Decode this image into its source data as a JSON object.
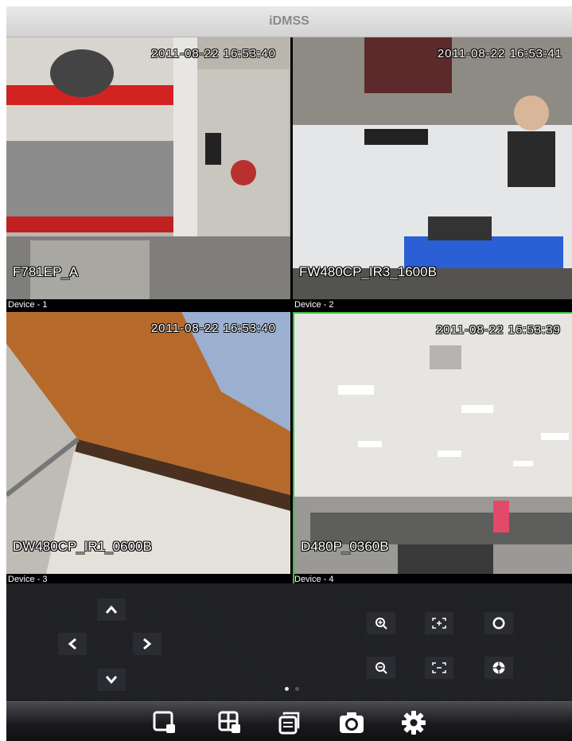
{
  "app": {
    "title": "iDMSS"
  },
  "cameras": [
    {
      "device_label": "Device - 1",
      "timestamp": "2011-08-22 16:53:40",
      "osd_name": "F781EP_A"
    },
    {
      "device_label": "Device - 2",
      "timestamp": "2011-08-22 16:53:41",
      "osd_name": "FW480CP_IR3_1600B"
    },
    {
      "device_label": "Device - 3",
      "timestamp": "2011-08-22 16:53:40",
      "osd_name": "DW480CP_IR1_0600B"
    },
    {
      "device_label": "Device - 4",
      "timestamp": "2011-08-22 16:53:39",
      "osd_name": "D480P_0360B",
      "selected": true
    }
  ],
  "ptz": {
    "direction_icons": [
      "chevron-up-icon",
      "chevron-left-icon",
      "chevron-right-icon",
      "chevron-down-icon"
    ],
    "action_icons": [
      "zoom-in-icon",
      "focus-near-icon",
      "iris-open-icon",
      "zoom-out-icon",
      "focus-far-icon",
      "iris-close-icon"
    ]
  },
  "pager": {
    "pages": 2,
    "current": 1
  },
  "toolbar": {
    "icons": [
      "single-view-icon",
      "quad-view-icon",
      "device-list-icon",
      "snapshot-camera-icon",
      "settings-gear-icon"
    ]
  },
  "colors": {
    "selected_border": "#3fbf3f",
    "title_text": "#8a8a8a",
    "control_bg": "#1f2024"
  }
}
